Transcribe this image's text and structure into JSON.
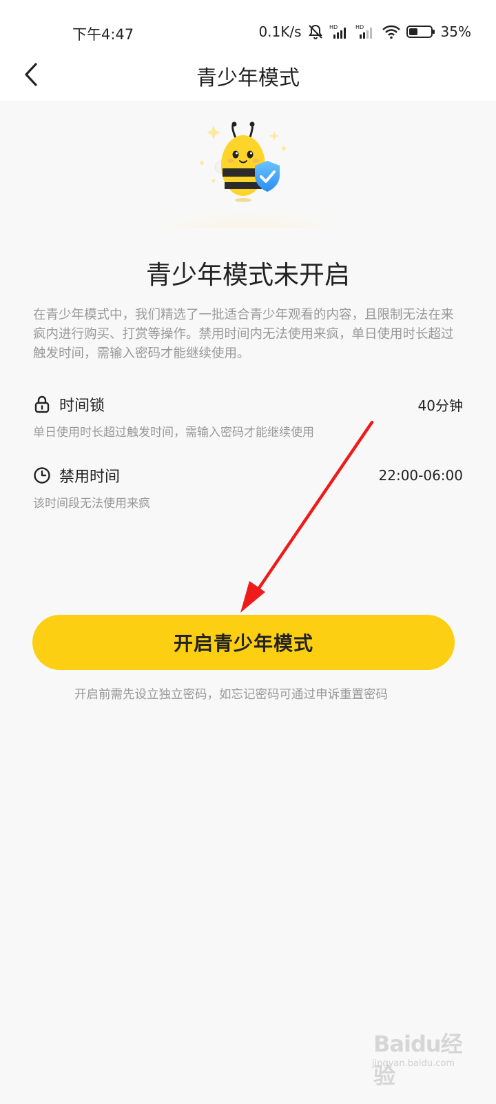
{
  "status_bar": {
    "time": "下午4:47",
    "network_speed": "0.1K/s",
    "battery": "35%",
    "icons": [
      "mute-bell-icon",
      "hd-signal-icon",
      "hd-signal-icon",
      "wifi-icon",
      "battery-icon"
    ]
  },
  "nav": {
    "title": "青少年模式",
    "back_icon": "chevron-left-icon"
  },
  "hero": {
    "icon": "bee-mascot-shield-icon"
  },
  "main": {
    "title": "青少年模式未开启",
    "description": "在青少年模式中，我们精选了一批适合青少年观看的内容，且限制无法在来疯内进行购买、打赏等操作。禁用时间内无法使用来疯，单日使用时长超过触发时间，需输入密码才能继续使用。"
  },
  "settings": [
    {
      "icon": "lock-icon",
      "label": "时间锁",
      "value": "40分钟",
      "sub": "单日使用时长超过触发时间，需输入密码才能继续使用"
    },
    {
      "icon": "clock-icon",
      "label": "禁用时间",
      "value": "22:00-06:00",
      "sub": "该时间段无法使用来疯"
    }
  ],
  "cta": {
    "label": "开启青少年模式"
  },
  "note": "开启前需先设立独立密码，如忘记密码可通过申诉重置密码",
  "watermark": {
    "brand": "Baidu经验",
    "url": "jingyan.baidu.com"
  },
  "colors": {
    "accent": "#fccf12",
    "annotation_arrow": "#ee1b1b",
    "muted_text": "#999999"
  }
}
